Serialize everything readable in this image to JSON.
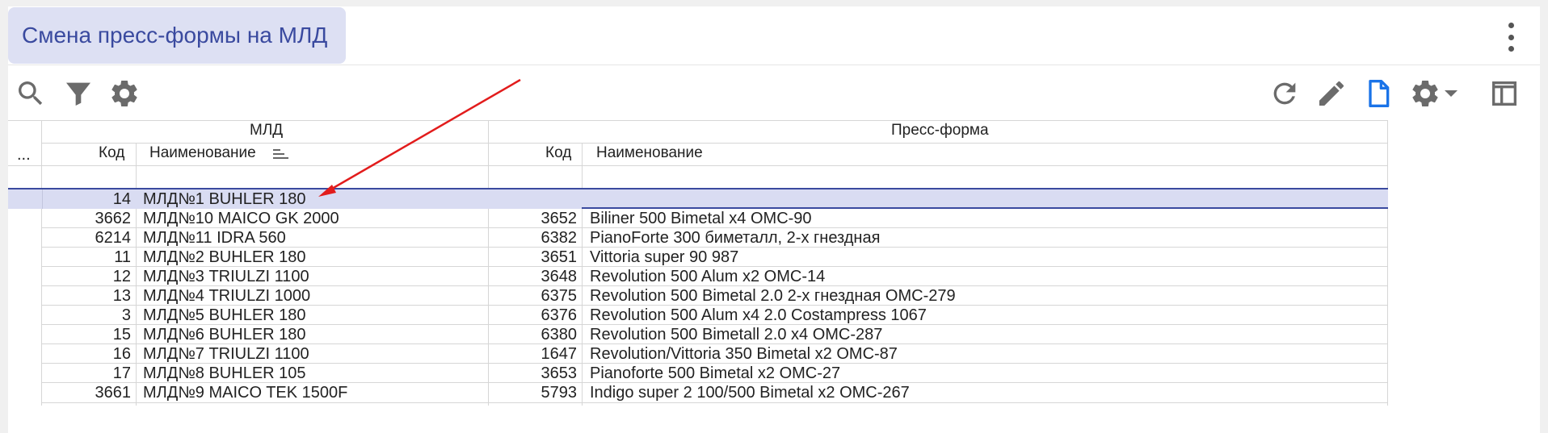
{
  "title": "Смена пресс-формы на МЛД",
  "icons": {
    "search": "search-icon",
    "filter": "filter-icon",
    "settings": "gear-icon",
    "refresh": "refresh-icon",
    "edit": "pencil-icon",
    "document": "document-icon",
    "settings_menu": "gear-dropdown-icon",
    "layout": "layout-icon",
    "more": "kebab-icon"
  },
  "colors": {
    "accent": "#3a4a9f",
    "title_bg": "#dde0f3",
    "selected_row_bg": "#d9dcf2",
    "document_icon": "#1a73e8",
    "arrow": "#e21c1c"
  },
  "table": {
    "row_selector_label": "...",
    "groups": {
      "mld": "МЛД",
      "mold": "Пресс-форма"
    },
    "columns": {
      "mld_code": "Код",
      "mld_name": "Наименование",
      "mold_code": "Код",
      "mold_name": "Наименование"
    },
    "rows": [
      {
        "mld_code": "14",
        "mld_name": "МЛД№1 BUHLER 180",
        "mold_code": "",
        "mold_name": "",
        "selected": true
      },
      {
        "mld_code": "3662",
        "mld_name": "МЛД№10 MAICO GK 2000",
        "mold_code": "3652",
        "mold_name": "Biliner 500 Bimetal x4 OMC-90"
      },
      {
        "mld_code": "6214",
        "mld_name": "МЛД№11 IDRA 560",
        "mold_code": "6382",
        "mold_name": "PianoForte 300 биметалл, 2-х гнездная"
      },
      {
        "mld_code": "11",
        "mld_name": "МЛД№2 BUHLER 180",
        "mold_code": "3651",
        "mold_name": "Vittoria super 90 987"
      },
      {
        "mld_code": "12",
        "mld_name": "МЛД№3 TRIULZI 1100",
        "mold_code": "3648",
        "mold_name": "Revolution 500 Alum x2 OMC-14"
      },
      {
        "mld_code": "13",
        "mld_name": "МЛД№4 TRIULZI 1000",
        "mold_code": "6375",
        "mold_name": "Revolution 500 Bimetal 2.0 2-х гнездная OMC-279"
      },
      {
        "mld_code": "3",
        "mld_name": "МЛД№5 BUHLER 180",
        "mold_code": "6376",
        "mold_name": "Revolution 500 Alum x4 2.0 Costampress 1067"
      },
      {
        "mld_code": "15",
        "mld_name": "МЛД№6 BUHLER 180",
        "mold_code": "6380",
        "mold_name": "Revolution 500 Bimetall 2.0 x4 OMC-287"
      },
      {
        "mld_code": "16",
        "mld_name": "МЛД№7 TRIULZI 1100",
        "mold_code": "1647",
        "mold_name": "Revolution/Vittoria 350 Bimetal x2 OMC-87"
      },
      {
        "mld_code": "17",
        "mld_name": "МЛД№8 BUHLER 105",
        "mold_code": "3653",
        "mold_name": "Pianoforte 500 Bimetal x2 OMC-27"
      },
      {
        "mld_code": "3661",
        "mld_name": "МЛД№9 MAICO TEK 1500F",
        "mold_code": "5793",
        "mold_name": "Indigo super 2 100/500 Bimetal x2 OMC-267"
      }
    ]
  }
}
